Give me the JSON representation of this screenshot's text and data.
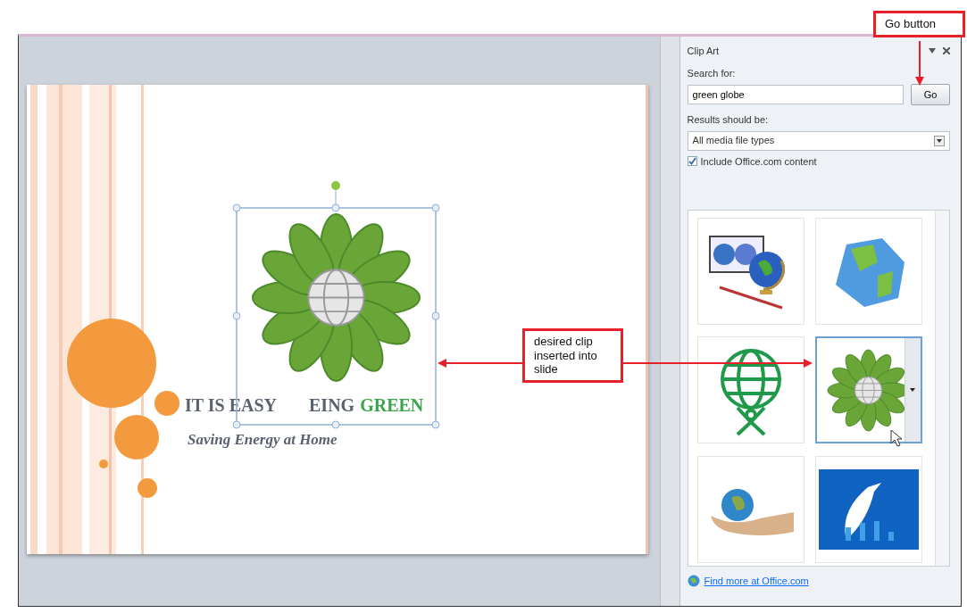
{
  "callouts": [
    {
      "text": "Go button"
    },
    {
      "text": "desired clip inserted into slide"
    }
  ],
  "slide": {
    "title": [
      {
        "text": "IT IS EASY",
        "kind": "plain"
      },
      {
        "text": "EING",
        "kind": "plain"
      },
      {
        "text": "GREEN",
        "kind": "accent"
      }
    ],
    "subtitle": "Saving Energy at Home"
  },
  "pane": {
    "title": "Clip Art",
    "search_label": "Search for:",
    "search_value": "green globe",
    "go": "Go",
    "results_label": "Results should be:",
    "results_value": "All media file types",
    "include": {
      "label": "Include Office.com content",
      "checked": true
    },
    "clips": [
      {
        "kind": "globes",
        "selected": false
      },
      {
        "kind": "earth",
        "selected": false
      },
      {
        "kind": "outline-globe",
        "selected": false
      },
      {
        "kind": "flower",
        "selected": true
      },
      {
        "kind": "hand-globe",
        "selected": false
      },
      {
        "kind": "bird",
        "selected": false
      }
    ],
    "find_more": "Find more at Office.com"
  }
}
